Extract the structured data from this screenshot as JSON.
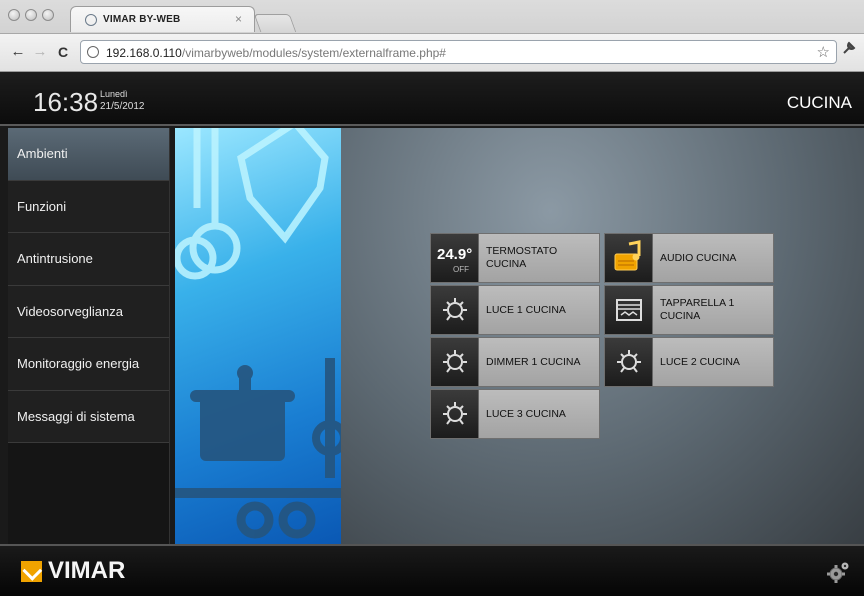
{
  "browser": {
    "tab_title": "VIMAR BY-WEB",
    "tab_close": "×",
    "url_host": "192.168.0.110",
    "url_path": "/vimarbyweb/modules/system/externalframe.php#",
    "nav_back": "←",
    "nav_forward": "→",
    "nav_reload": "C",
    "star": "☆",
    "wrench": "🔧"
  },
  "header": {
    "time": "16:38",
    "day": "Lunedì",
    "date": "21/5/2012",
    "room": "CUCINA"
  },
  "sidebar": {
    "items": [
      {
        "label": "Ambienti",
        "active": true
      },
      {
        "label": "Funzioni",
        "active": false
      },
      {
        "label": "Antintrusione",
        "active": false
      },
      {
        "label": "Videosorveglianza",
        "active": false
      },
      {
        "label": "Monitoraggio energia",
        "active": false
      },
      {
        "label": "Messaggi di sistema",
        "active": false
      }
    ]
  },
  "tiles": [
    {
      "label": "TERMOSTATO CUCINA",
      "icon": "thermostat-icon",
      "value": "24.9°",
      "state": "OFF"
    },
    {
      "label": "AUDIO CUCINA",
      "icon": "audio-icon"
    },
    {
      "label": "LUCE 1 CUCINA",
      "icon": "light-bulb-icon"
    },
    {
      "label": "TAPPARELLA 1 CUCINA",
      "icon": "shutter-icon"
    },
    {
      "label": "DIMMER 1 CUCINA",
      "icon": "dimmer-bulb-icon"
    },
    {
      "label": "LUCE 2 CUCINA",
      "icon": "light-bulb-icon"
    },
    {
      "label": "LUCE 3 CUCINA",
      "icon": "light-bulb-icon"
    }
  ],
  "footer": {
    "brand": "VIMAR",
    "settings_icon": "gear-icon"
  },
  "colors": {
    "accent": "#f0a300",
    "sidebar_active": "#5b6a76"
  }
}
